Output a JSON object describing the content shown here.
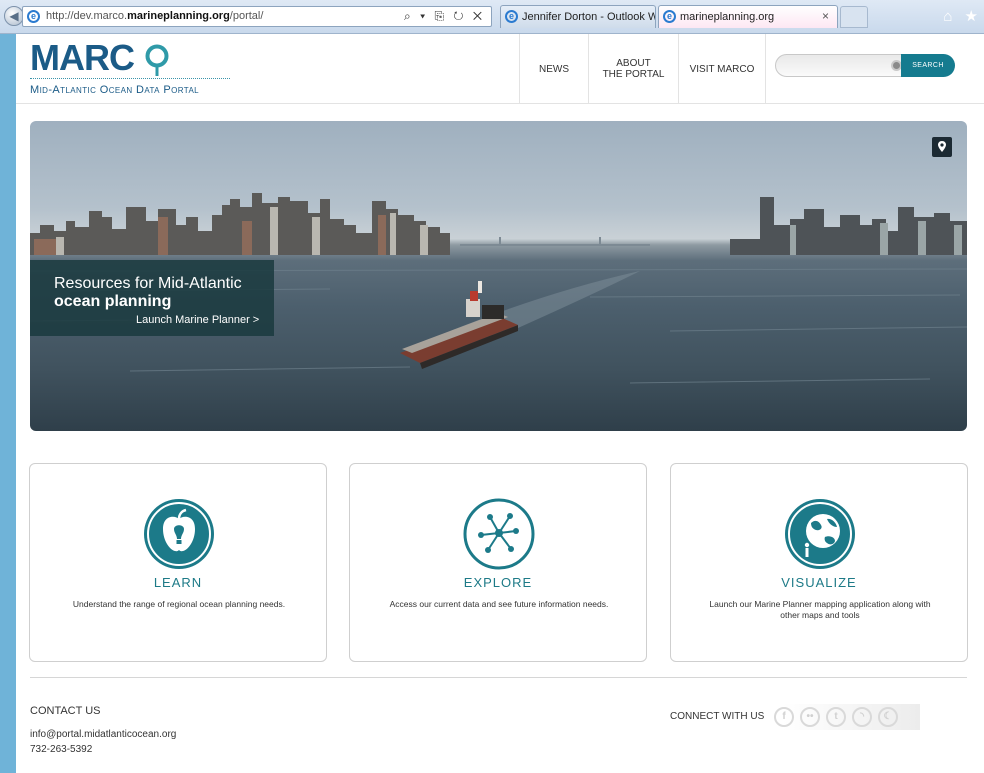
{
  "browser": {
    "url_prefix": "http://dev.marco.",
    "url_domain": "marineplanning.org",
    "url_path": "/portal/",
    "address_controls": "⌕ ▾ ⎘ ↻ ✕",
    "tabs": [
      {
        "label": "Jennifer Dorton - Outlook Web..."
      },
      {
        "label": "marineplanning.org"
      }
    ],
    "tab_close": "×",
    "tool_icons": "⌂ ★"
  },
  "header": {
    "logo_text": "MARC",
    "logo_subtitle": "Mid-Atlantic Ocean Data Portal",
    "nav": {
      "news": "NEWS",
      "about_line1": "ABOUT",
      "about_line2": "THE PORTAL",
      "visit": "VISIT MARCO"
    },
    "search": {
      "placeholder": "",
      "button": "SEARCH"
    }
  },
  "hero": {
    "caption_line1": "Resources for Mid-Atlantic",
    "caption_line2": "ocean planning",
    "caption_link": "Launch Marine Planner >"
  },
  "cards": [
    {
      "title": "LEARN",
      "description": "Understand the range of regional ocean planning needs."
    },
    {
      "title": "EXPLORE",
      "description": "Access our current data and see future information needs."
    },
    {
      "title": "VISUALIZE",
      "description": "Launch our Marine Planner mapping application along with other maps and tools"
    }
  ],
  "footer": {
    "contact_title": "CONTACT US",
    "email": "info@portal.midatlanticocean.org",
    "phone": "732-263-5392",
    "connect_label": "CONNECT WITH US",
    "social_glyphs": [
      "f",
      "••",
      "t",
      "◝",
      "☾"
    ]
  },
  "colors": {
    "brand_blue": "#1b5b87",
    "teal": "#157b8f",
    "card_title": "#1d7a87"
  }
}
